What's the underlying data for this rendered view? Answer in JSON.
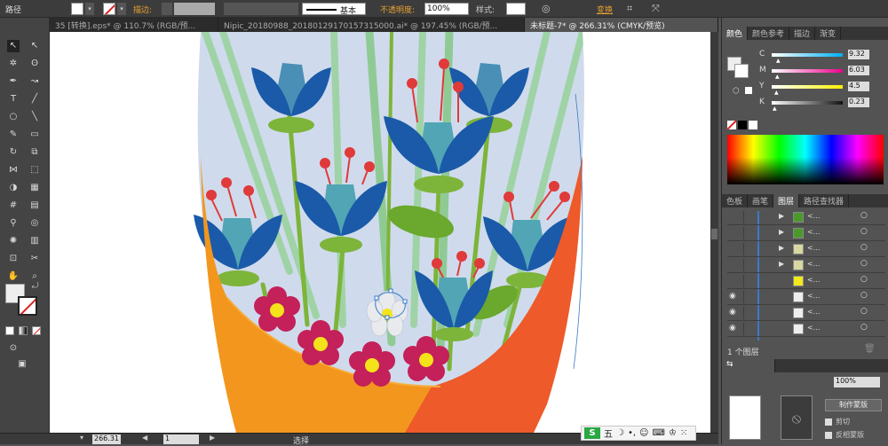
{
  "control_bar": {
    "label": "路径",
    "stroke_label": "描边:",
    "brush_label": "基本",
    "opacity_label": "不透明度:",
    "opacity_value": "100%",
    "style_label": "样式:",
    "transform_label": "变换"
  },
  "doc_tabs": [
    {
      "label": "35 [转换].eps* @ 110.7% (RGB/预...",
      "active": false
    },
    {
      "label": "Nipic_20180988_20180129170157315000.ai* @ 197.45% (RGB/预...",
      "active": false
    },
    {
      "label": "未标题-7* @ 266.31% (CMYK/预览)",
      "active": true
    }
  ],
  "status_bar": {
    "zoom": "266.31",
    "page": "1",
    "tool": "选择"
  },
  "ime": {
    "label": "五"
  },
  "color_panel": {
    "tabs": [
      "颜色",
      "颜色参考",
      "描边",
      "渐变"
    ],
    "channels": [
      {
        "name": "C",
        "value": "9.32",
        "fraction": 0.09,
        "color": "#00aeef"
      },
      {
        "name": "M",
        "value": "6.03",
        "fraction": 0.06,
        "color": "#ec008c"
      },
      {
        "name": "Y",
        "value": "4.5",
        "fraction": 0.045,
        "color": "#fff200"
      },
      {
        "name": "K",
        "value": "0.23",
        "fraction": 0.002,
        "color": "#111111"
      }
    ]
  },
  "layers_panel": {
    "tabs": [
      "色板",
      "画笔",
      "图层",
      "路径查找器"
    ],
    "rows": [
      {
        "name": "<...",
        "thumb": "#4a9a2a",
        "visible": false
      },
      {
        "name": "<...",
        "thumb": "#4a9a2a",
        "visible": false
      },
      {
        "name": "<...",
        "thumb": "#d8d8a0",
        "visible": false
      },
      {
        "name": "<...",
        "thumb": "#d8d8a0",
        "visible": false
      },
      {
        "name": "<...",
        "thumb": "#f2ea1a",
        "visible": false
      },
      {
        "name": "<...",
        "thumb": "#eeeeee",
        "visible": true
      },
      {
        "name": "<...",
        "thumb": "#eeeeee",
        "visible": true
      },
      {
        "name": "<...",
        "thumb": "#eeeeee",
        "visible": true
      }
    ],
    "footer": "1 个图层"
  },
  "transparency_panel": {
    "opacity": "100%",
    "make_mask": "制作蒙版",
    "clip": "剪切",
    "invert_mask": "反相蒙版"
  }
}
